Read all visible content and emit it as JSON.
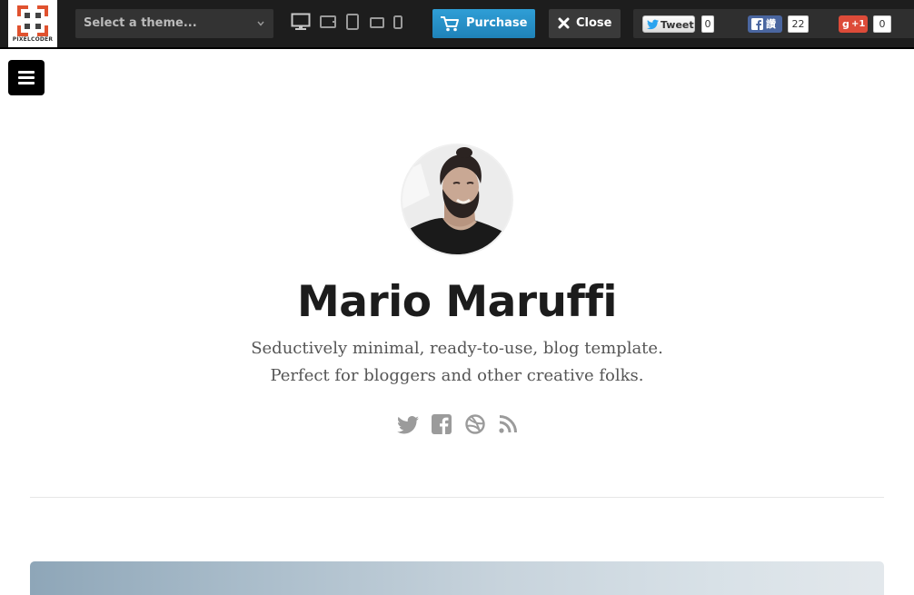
{
  "topbar": {
    "logo_text": "PIXELCODER",
    "theme_select_placeholder": "Select a theme...",
    "devices": [
      "desktop-icon",
      "laptop-icon",
      "tablet-portrait-icon",
      "tablet-landscape-icon",
      "phone-icon"
    ],
    "purchase_label": "Purchase",
    "close_label": "Close",
    "social": {
      "tweet_label": "Tweet",
      "tweet_count": "0",
      "facebook_label": "讚",
      "facebook_count": "22",
      "gplus_label": "+1",
      "gplus_count": "0"
    }
  },
  "profile": {
    "name": "Mario Maruffi",
    "tagline_line1": "Seductively minimal, ready-to-use, blog template.",
    "tagline_line2": "Perfect for bloggers and other creative folks.",
    "social_icons": [
      "twitter-icon",
      "facebook-icon",
      "dribbble-icon",
      "rss-icon"
    ]
  },
  "colors": {
    "topbar_bg": "#1d1d1d",
    "purchase_bg": "#2a92cb",
    "logo_accent": "#e0522f"
  }
}
